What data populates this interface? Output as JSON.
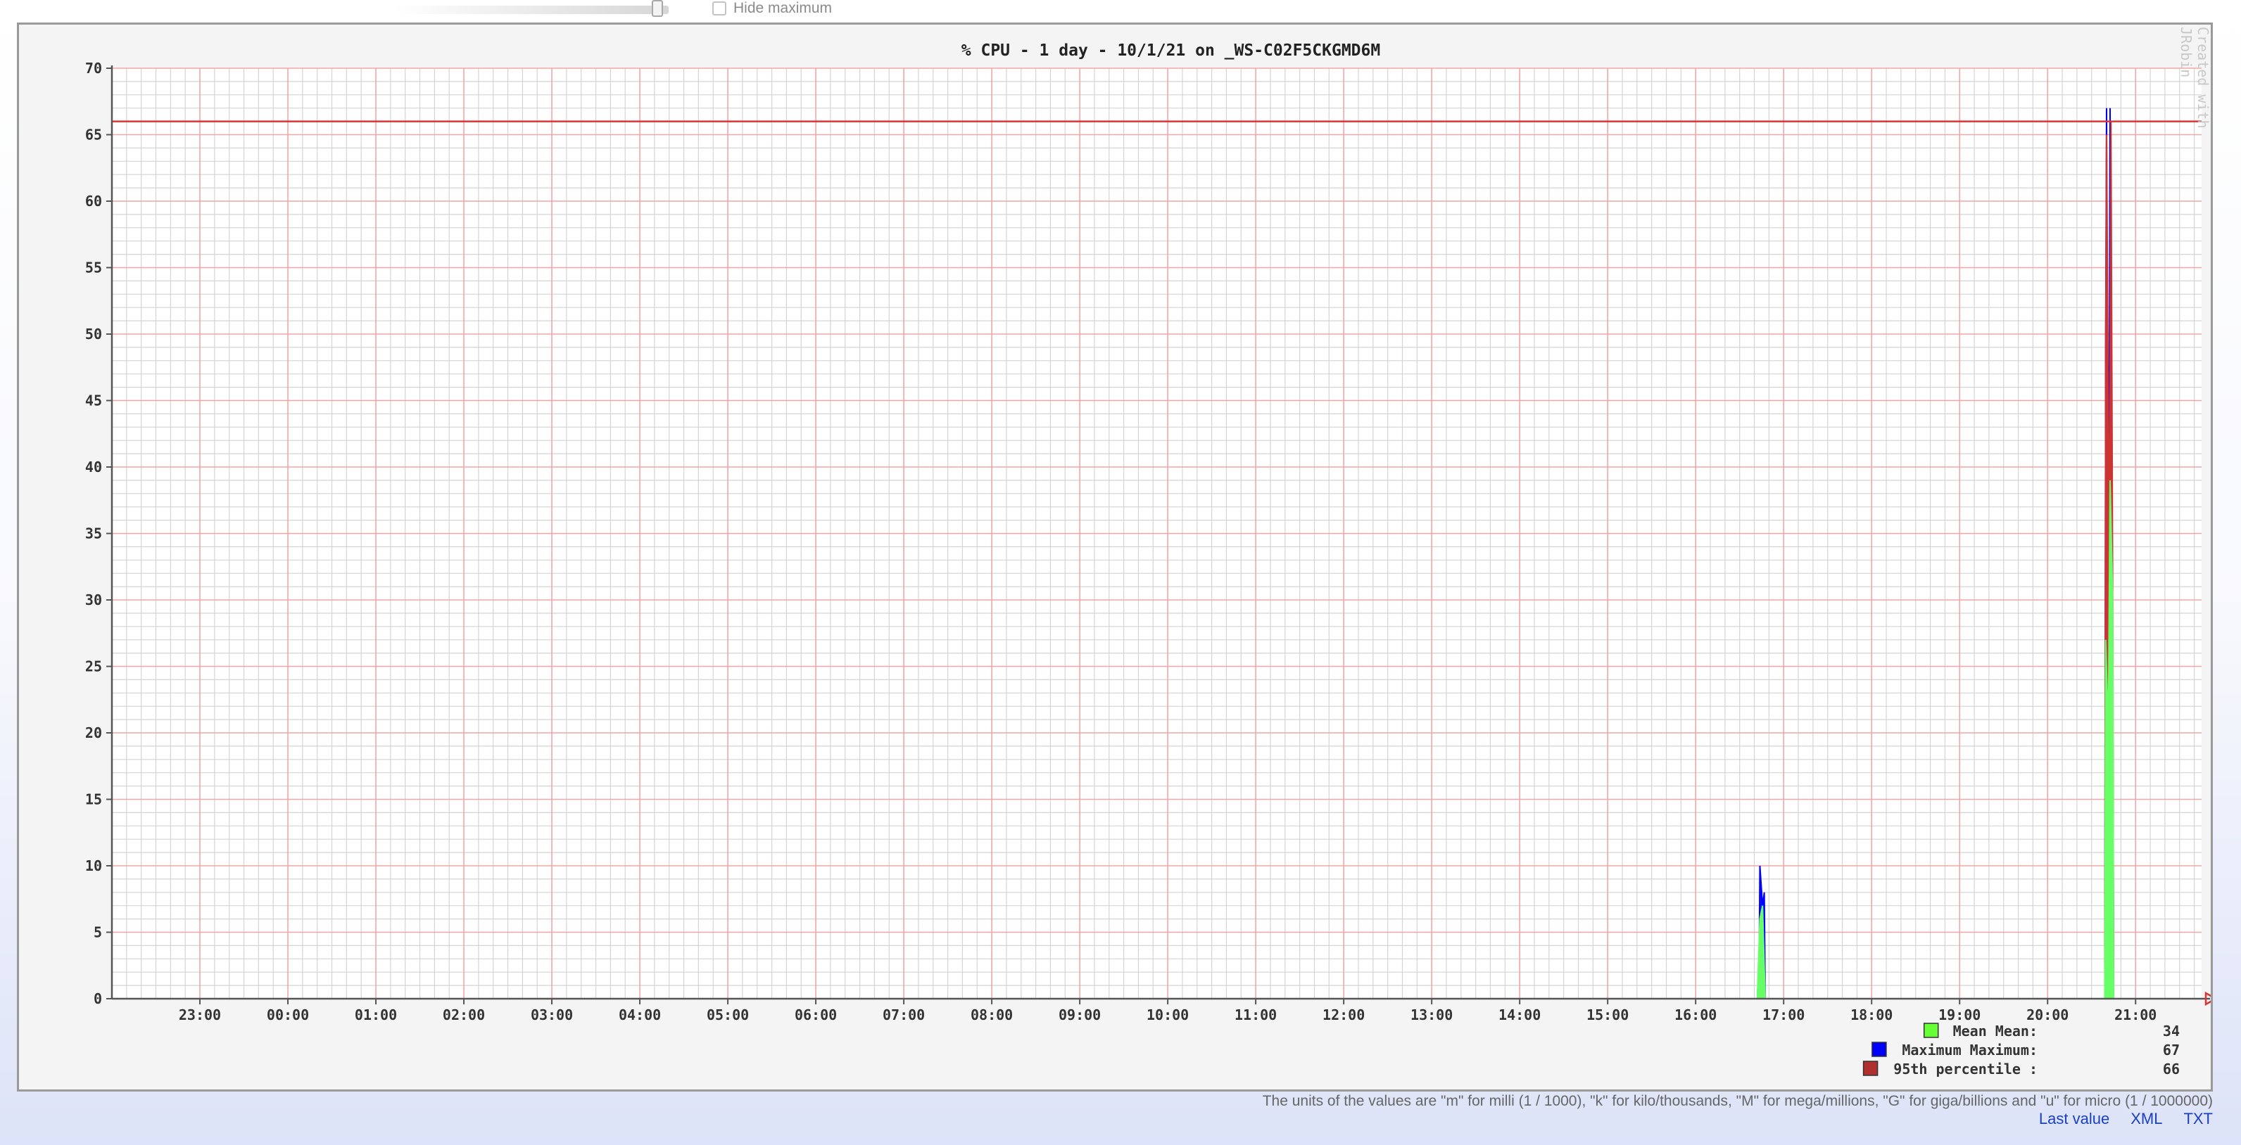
{
  "controls": {
    "hide_maximum_label": "Hide maximum",
    "hide_maximum_checked": false
  },
  "watermark": "Created with JRobin",
  "footer": {
    "units_note": "The units of the values are \"m\" for milli (1 / 1000), \"k\" for kilo/thousands, \"M\" for mega/millions, \"G\" for giga/billions and \"u\" for micro (1 / 1000000)",
    "links": [
      "Last value",
      "XML",
      "TXT"
    ]
  },
  "chart_data": {
    "type": "area",
    "title": "% CPU - 1 day - 10/1/21 on _WS-C02F5CKGMD6M",
    "xlabel": "",
    "ylabel": "",
    "ylim": [
      0,
      70
    ],
    "y_ticks": [
      0,
      5,
      10,
      15,
      20,
      25,
      30,
      35,
      40,
      45,
      50,
      55,
      60,
      65,
      70
    ],
    "x_ticks": [
      "23:00",
      "00:00",
      "01:00",
      "02:00",
      "03:00",
      "04:00",
      "05:00",
      "06:00",
      "07:00",
      "08:00",
      "09:00",
      "10:00",
      "11:00",
      "12:00",
      "13:00",
      "14:00",
      "15:00",
      "16:00",
      "17:00",
      "18:00",
      "19:00",
      "20:00",
      "21:00"
    ],
    "xlim": [
      -1,
      22.75
    ],
    "grid": true,
    "legend_position": "bottom-right",
    "series": [
      {
        "name": "Maximum",
        "color": "#0000ff",
        "points": [
          [
            -1,
            0
          ],
          [
            17.7,
            0
          ],
          [
            17.72,
            0.5
          ],
          [
            17.73,
            10
          ],
          [
            17.76,
            7
          ],
          [
            17.78,
            8
          ],
          [
            17.79,
            0
          ],
          [
            21.65,
            0
          ],
          [
            21.66,
            50
          ],
          [
            21.67,
            67
          ],
          [
            21.69,
            20
          ],
          [
            21.71,
            67
          ],
          [
            21.74,
            25
          ],
          [
            21.75,
            0
          ],
          [
            22.75,
            0
          ]
        ]
      },
      {
        "name": "95th percentile",
        "color": "#cc3333",
        "points": [
          [
            -1,
            0
          ],
          [
            21.65,
            0
          ],
          [
            21.66,
            49
          ],
          [
            21.67,
            65
          ],
          [
            21.68,
            55
          ],
          [
            21.7,
            30
          ],
          [
            21.72,
            66
          ],
          [
            21.74,
            30
          ],
          [
            21.75,
            0
          ],
          [
            22.75,
            0
          ]
        ]
      },
      {
        "name": "Mean",
        "color": "#66ff66",
        "points": [
          [
            -1,
            0
          ],
          [
            17.7,
            0
          ],
          [
            17.73,
            6
          ],
          [
            17.76,
            7
          ],
          [
            17.79,
            0
          ],
          [
            21.65,
            0
          ],
          [
            21.66,
            27
          ],
          [
            21.69,
            20
          ],
          [
            21.71,
            39
          ],
          [
            21.74,
            30
          ],
          [
            21.75,
            0
          ],
          [
            22.75,
            0
          ]
        ]
      }
    ],
    "threshold": {
      "value": 66,
      "color": "#dd3333"
    },
    "legend": [
      {
        "name": "Mean",
        "label": "Mean  Mean:",
        "value": "34",
        "color": "#66ff33"
      },
      {
        "name": "Maximum",
        "label": "Maximum  Maximum:",
        "value": "67",
        "color": "#0000ff"
      },
      {
        "name": "95th percentile",
        "label": "95th percentile  :",
        "value": "66",
        "color": "#b03030"
      }
    ]
  }
}
